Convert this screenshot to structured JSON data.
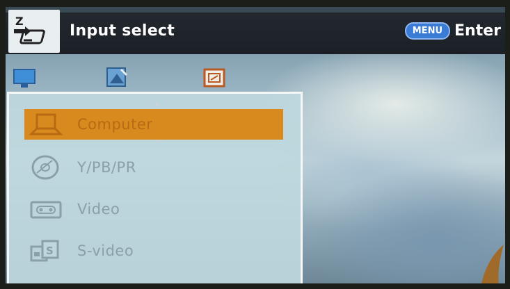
{
  "header": {
    "title": "Input select",
    "menu_button_label": "MENU",
    "menu_action_label": "Enter",
    "input_icon": "input-switch-icon"
  },
  "tabs": [
    {
      "icon": "monitor-icon"
    },
    {
      "icon": "image-adjust-icon"
    },
    {
      "icon": "display-settings-icon"
    }
  ],
  "input_menu": {
    "items": [
      {
        "label": "Computer",
        "icon": "laptop-icon",
        "selected": true
      },
      {
        "label": "Y/PB/PR",
        "icon": "disc-icon",
        "selected": false
      },
      {
        "label": "Video",
        "icon": "videotape-icon",
        "selected": false
      },
      {
        "label": "S-video",
        "icon": "s-video-icon",
        "selected": false
      }
    ]
  },
  "colors": {
    "topbar": "#1b2026",
    "selection": "#d98a1f",
    "selected_text": "#b86a12",
    "menu_panel": "#bed7de",
    "menu_pill": "#3a7bd6"
  }
}
